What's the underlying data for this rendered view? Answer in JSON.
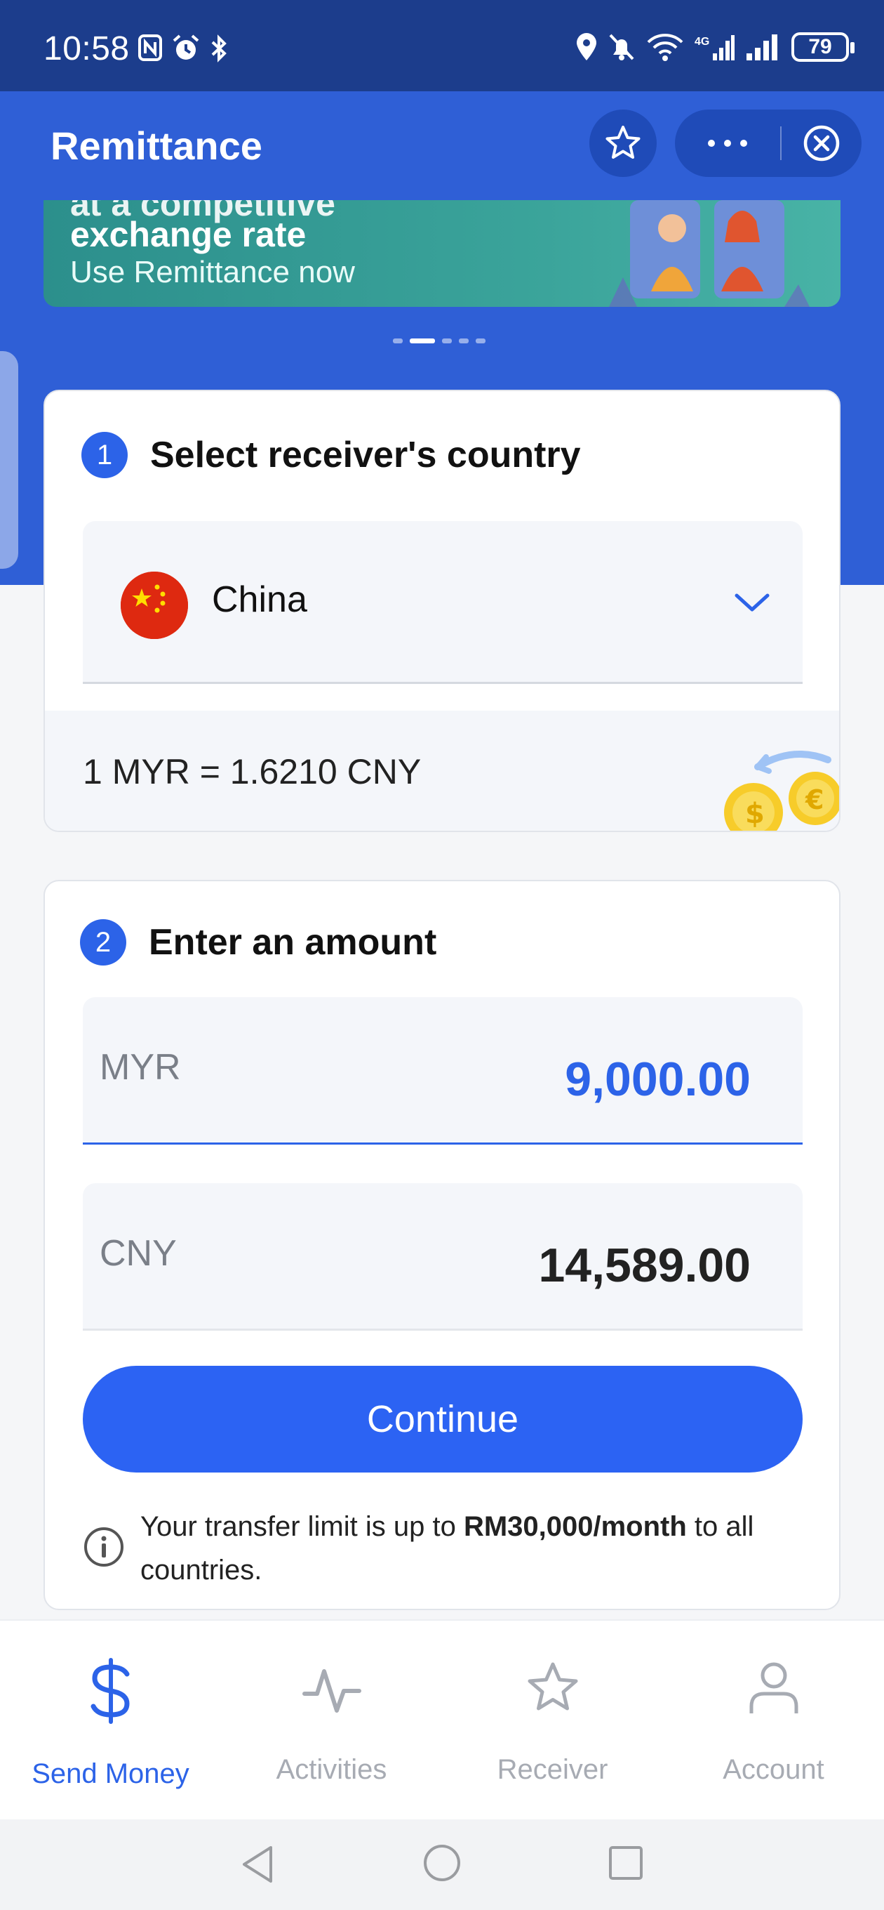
{
  "status_bar": {
    "time": "10:58",
    "battery": "79"
  },
  "header": {
    "title": "Remittance"
  },
  "banner": {
    "line1": "at a competitive",
    "line2": "exchange rate",
    "line3": "Use Remittance now"
  },
  "step1": {
    "number": "1",
    "title": "Select receiver's country",
    "country": "China",
    "rate": "1 MYR = 1.6210 CNY"
  },
  "step2": {
    "number": "2",
    "title": "Enter an amount",
    "send_currency": "MYR",
    "send_amount": "9,000.00",
    "receive_currency": "CNY",
    "receive_amount": "14,589.00",
    "continue_label": "Continue",
    "limit_prefix": "Your transfer limit is up to ",
    "limit_value": "RM30,000/month",
    "limit_suffix": " to all countries."
  },
  "bottom_nav": {
    "items": [
      {
        "label": "Send Money",
        "icon": "dollar-icon",
        "active": true
      },
      {
        "label": "Activities",
        "icon": "activity-icon",
        "active": false
      },
      {
        "label": "Receiver",
        "icon": "star-icon",
        "active": false
      },
      {
        "label": "Account",
        "icon": "user-icon",
        "active": false
      }
    ]
  },
  "colors": {
    "status_bar": "#1c3d8c",
    "header_blue": "#2f5fd6",
    "accent": "#2c63e8",
    "button": "#2c63f3"
  }
}
